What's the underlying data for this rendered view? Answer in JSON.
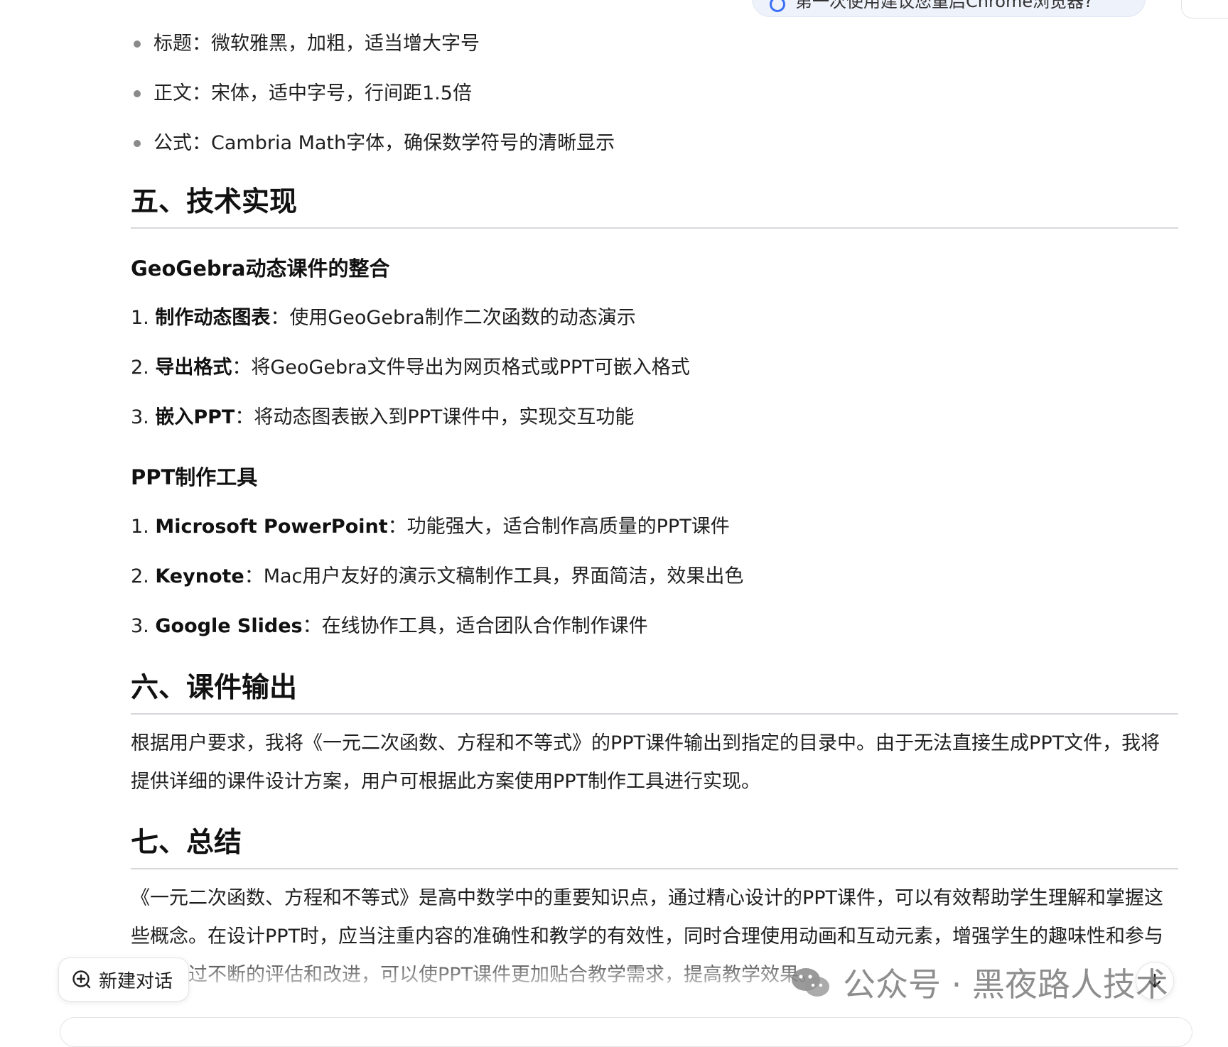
{
  "top_banner": {
    "text": "第一次使用建议您重启Chrome浏览器?"
  },
  "font_list": [
    "标题：微软雅黑，加粗，适当增大字号",
    "正文：宋体，适中字号，行间距1.5倍",
    "公式：Cambria Math字体，确保数学符号的清晰显示"
  ],
  "section5": {
    "title": "五、技术实现",
    "geogebra": {
      "title": "GeoGebra动态课件的整合",
      "items": [
        {
          "num": "1.",
          "bold": "制作动态图表",
          "text": "：使用GeoGebra制作二次函数的动态演示"
        },
        {
          "num": "2.",
          "bold": "导出格式",
          "text": "：将GeoGebra文件导出为网页格式或PPT可嵌入格式"
        },
        {
          "num": "3.",
          "bold": "嵌入PPT",
          "text": "：将动态图表嵌入到PPT课件中，实现交互功能"
        }
      ]
    },
    "tools": {
      "title": "PPT制作工具",
      "items": [
        {
          "num": "1.",
          "bold": "Microsoft PowerPoint",
          "text": "：功能强大，适合制作高质量的PPT课件"
        },
        {
          "num": "2.",
          "bold": "Keynote",
          "text": "：Mac用户友好的演示文稿制作工具，界面简洁，效果出色"
        },
        {
          "num": "3.",
          "bold": "Google Slides",
          "text": "：在线协作工具，适合团队合作制作课件"
        }
      ]
    }
  },
  "section6": {
    "title": "六、课件输出",
    "paragraph": "根据用户要求，我将《一元二次函数、方程和不等式》的PPT课件输出到指定的目录中。由于无法直接生成PPT文件，我将提供详细的课件设计方案，用户可根据此方案使用PPT制作工具进行实现。"
  },
  "section7": {
    "title": "七、总结",
    "paragraph": "《一元二次函数、方程和不等式》是高中数学中的重要知识点，通过精心设计的PPT课件，可以有效帮助学生理解和掌握这些概念。在设计PPT时，应当注重内容的准确性和教学的有效性，同时合理使用动画和互动元素，增强学生的趣味性和参与度。通过不断的评估和改进，可以使PPT课件更加贴合教学需求，提高教学效果。"
  },
  "new_chat": {
    "label": "新建对话",
    "icon": "plus-circle-icon"
  },
  "scroll_button": {
    "icon": "arrow-down-icon"
  },
  "watermark": {
    "text": "公众号 · 黑夜路人技术",
    "icon": "wechat-icon"
  },
  "colors": {
    "accent": "#3b6ff5",
    "text": "#1f1f1f",
    "divider": "#d8d8dc"
  }
}
